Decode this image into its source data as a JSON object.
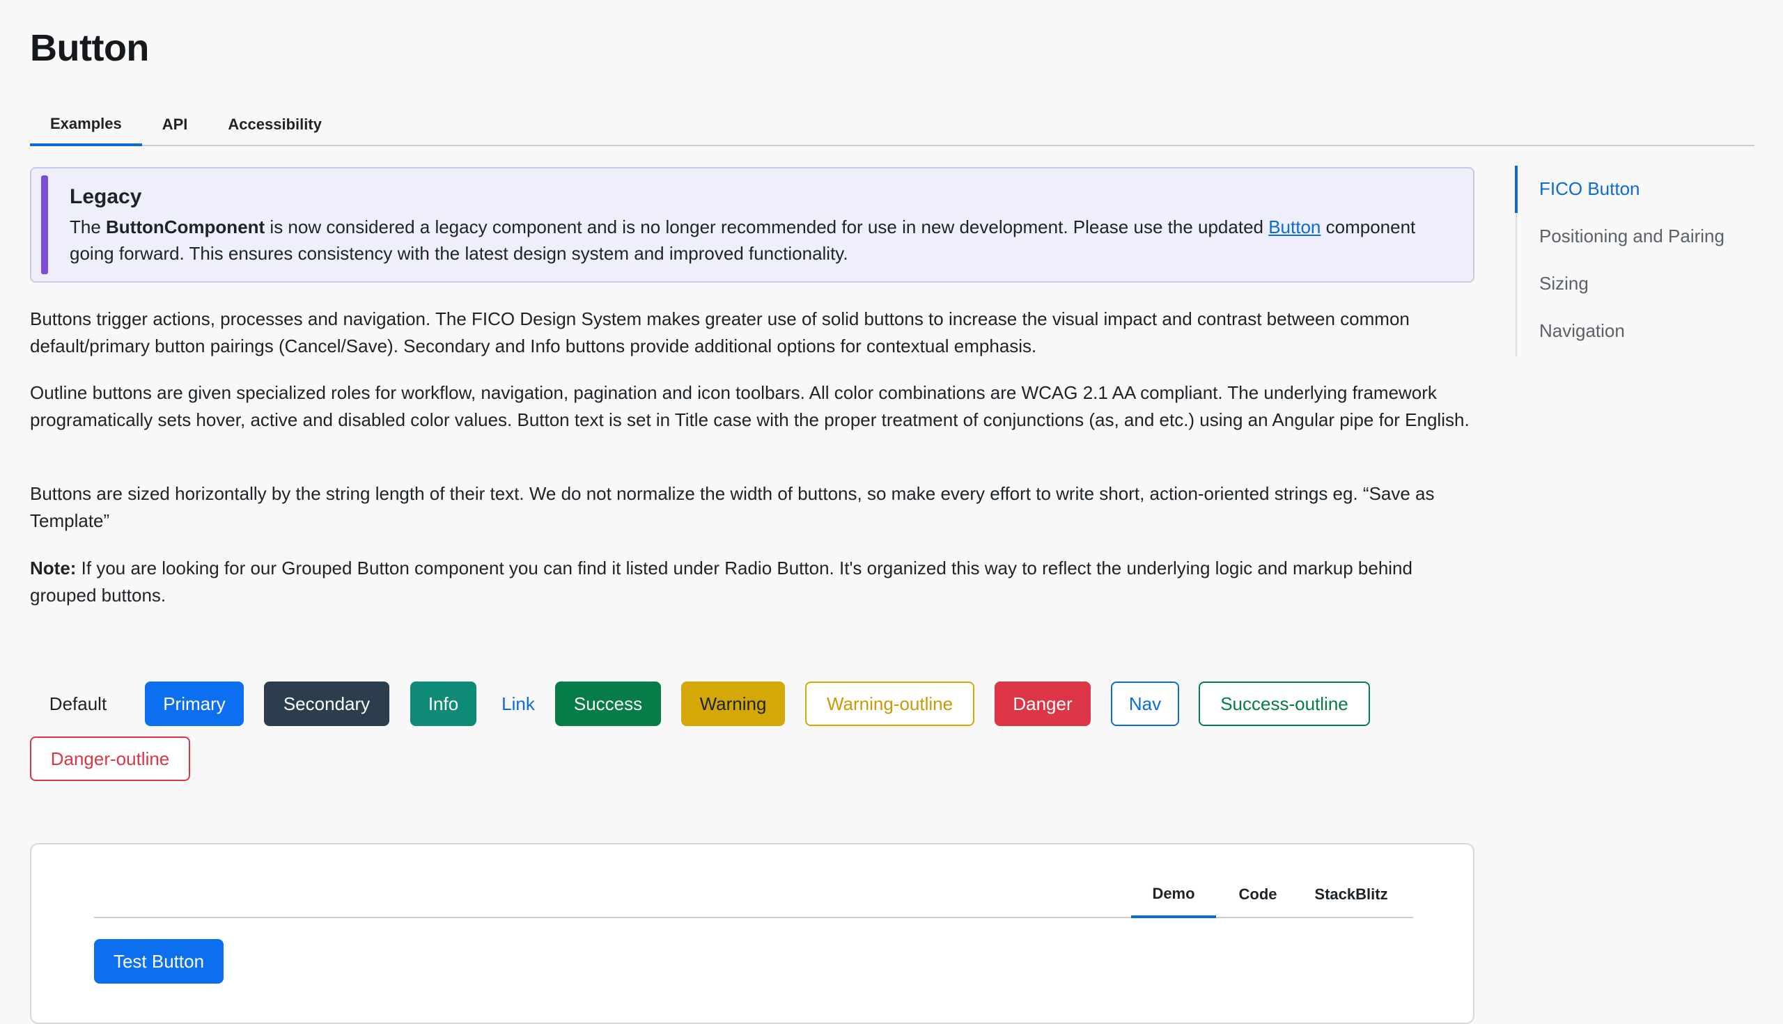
{
  "page": {
    "title": "Button"
  },
  "tabs": [
    "Examples",
    "API",
    "Accessibility"
  ],
  "callout": {
    "title": "Legacy",
    "text_prefix": "The ",
    "text_bold": "ButtonComponent",
    "text_mid": " is now considered a legacy component and is no longer recommended for use in new development. Please use the updated ",
    "link": "Button",
    "text_suffix": " component going forward. This ensures consistency with the latest design system and improved functionality."
  },
  "paragraphs": {
    "p1": "Buttons trigger actions, processes and navigation. The FICO Design System makes greater use of solid buttons to increase the visual impact and contrast between common default/primary button pairings (Cancel/Save). Secondary and Info buttons provide additional options for contextual emphasis.",
    "p2": "Outline buttons are given specialized roles for workflow, navigation, pagination and icon toolbars. All color combinations are WCAG 2.1 AA compliant. The underlying framework programatically sets hover, active and disabled color values. Button text is set in Title case with the proper treatment of conjunctions (as, and etc.) using an Angular pipe for English.",
    "p3": "Buttons are sized horizontally by the string length of their text. We do not normalize the width of buttons, so make every effort to write short, action-oriented strings eg. “Save as Template”",
    "p4_bold": "Note:",
    "p4_text": " If you are looking for our Grouped Button component you can find it listed under Radio Button. It's organized this way to reflect the underlying logic and markup behind grouped buttons."
  },
  "buttons": {
    "default": "Default",
    "primary": "Primary",
    "secondary": "Secondary",
    "info": "Info",
    "link": "Link",
    "success": "Success",
    "warning": "Warning",
    "warning_outline": "Warning-outline",
    "danger": "Danger",
    "nav": "Nav",
    "success_outline": "Success-outline",
    "danger_outline": "Danger-outline"
  },
  "demo": {
    "tabs": [
      "Demo",
      "Code",
      "StackBlitz"
    ],
    "test_button": "Test Button"
  },
  "toc": [
    "FICO Button",
    "Positioning and Pairing",
    "Sizing",
    "Navigation"
  ],
  "colors": {
    "accent": "#0b6bd8",
    "primary": "#0b6ff0",
    "secondary": "#2c3e4d",
    "info": "#0f8a76",
    "success": "#067c49",
    "warning": "#d4a806",
    "danger": "#dc3545",
    "legacy_bar": "#7b4fd6"
  }
}
